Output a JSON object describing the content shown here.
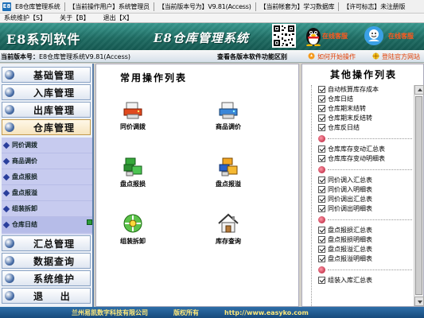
{
  "titlebar": {
    "app_icon_text": "E8",
    "items": [
      "E8仓库管理系统",
      "【当前操作用户】系统管理员",
      "【当前版本号为】V9.81(Access)",
      "【当前帐套为】学习数据库",
      "【许可标志】未注册版"
    ]
  },
  "menubar": {
    "items": [
      "系统维护【S】",
      "关于【B】",
      "退出【X】"
    ]
  },
  "banner": {
    "title": "E8系列软件",
    "subtitle": "E8仓库管理系统",
    "qq_label": "在线客服",
    "cs_label": "在线客服"
  },
  "infobar": {
    "version_label": "当前版本号：",
    "version_value": "E8仓库管理系统V9.81(Access)",
    "view_diff": "查看各版本软件功能区别",
    "start_op": "如何开始操作",
    "login_site": "登陆官方网站"
  },
  "sidebar": {
    "nav_top": [
      "基础管理",
      "入库管理",
      "出库管理",
      "仓库管理"
    ],
    "sub_items": [
      "同价调拨",
      "商品调价",
      "盘点报损",
      "盘点报溢",
      "组装拆卸",
      "仓库日结"
    ],
    "nav_bottom": [
      "汇总管理",
      "数据查询",
      "系统维护",
      "退    出"
    ]
  },
  "common": {
    "title": "常用操作列表",
    "ops": [
      "同价调拨",
      "商品调价",
      "盘点报损",
      "盘点报溢",
      "组装拆卸",
      "库存查询"
    ]
  },
  "other": {
    "title": "其他操作列表",
    "group1": [
      "自动核算库存成本",
      "仓库日结",
      "仓库期末结转",
      "仓库期末反结转",
      "仓库反日结"
    ],
    "group2": [
      "仓库库存变动汇总表",
      "仓库库存变动明细表"
    ],
    "group3": [
      "同价调入汇总表",
      "同价调入明细表",
      "同价调出汇总表",
      "同价调出明细表"
    ],
    "group4": [
      "盘点报损汇总表",
      "盘点报损明细表",
      "盘点报溢汇总表",
      "盘点报溢明细表"
    ],
    "group5": [
      "组装入库汇总表"
    ]
  },
  "footer": {
    "company": "兰州易凯数字科技有限公司",
    "rights": "版权所有",
    "site": "http://www.easyko.com"
  },
  "colors": {
    "banner": "#1f6d64",
    "sidebar_border": "#5c7ea8",
    "subpanel": "#c7cbef",
    "footer": "#174a7c",
    "accent_text": "#e03c00"
  }
}
